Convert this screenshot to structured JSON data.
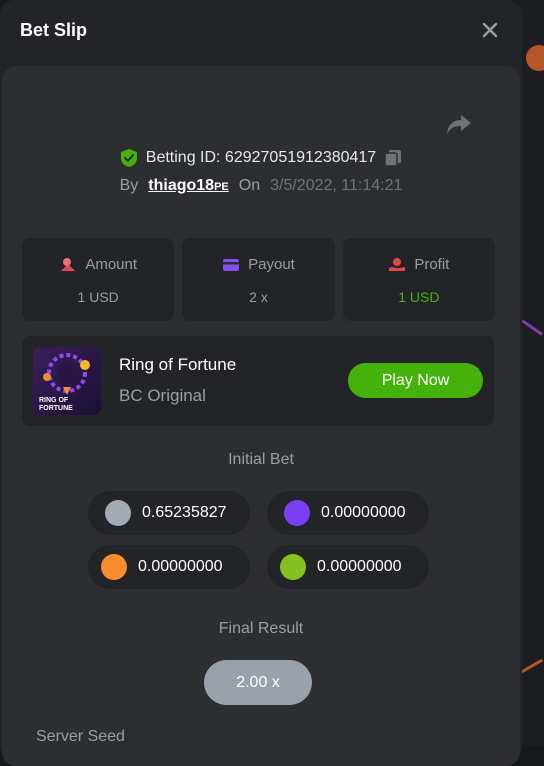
{
  "modal": {
    "title": "Bet Slip"
  },
  "bet": {
    "betting_id": "Betting ID: 62927051912380417",
    "by_label": "By",
    "user": "thiago18",
    "user_suffix": "PE",
    "on_label": "On",
    "date": "3/5/2022, 11:14:21"
  },
  "stats": [
    {
      "label": "Amount",
      "value": "1 USD",
      "icon": "coins-icon"
    },
    {
      "label": "Payout",
      "value": "2 x",
      "icon": "card-icon"
    },
    {
      "label": "Profit",
      "value": "1 USD",
      "icon": "profit-hand-icon"
    }
  ],
  "game": {
    "name": "Ring of Fortune",
    "subtitle": "BC Original",
    "play_label": "Play Now",
    "thumb_text": "RING OF FORTUNE"
  },
  "initial_bet": {
    "label": "Initial Bet",
    "chips": [
      {
        "color": "#a3aab4",
        "value": "0.65235827"
      },
      {
        "color": "#7c3ef2",
        "value": "0.00000000"
      },
      {
        "color": "#f98c2c",
        "value": "0.00000000"
      },
      {
        "color": "#86c11f",
        "value": "0.00000000"
      }
    ]
  },
  "final_result": {
    "label": "Final Result",
    "value": "2.00 x"
  },
  "server_seed": {
    "label": "Server Seed"
  },
  "colors": {
    "accent_green": "#45b20c",
    "profit_green": "#43b309"
  }
}
